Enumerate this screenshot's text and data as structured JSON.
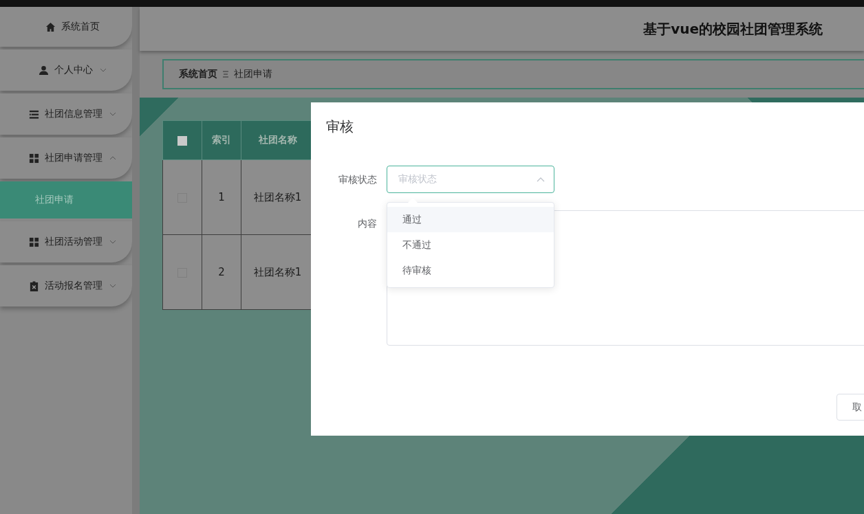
{
  "header": {
    "title": "基于vue的校园社团管理系统"
  },
  "sidebar": {
    "items": [
      {
        "label": "系统首页",
        "selected": false
      },
      {
        "label": "个人中心",
        "selected": false,
        "expanded": false
      },
      {
        "label": "社团信息管理",
        "selected": false,
        "expanded": false
      },
      {
        "label": "社团申请管理",
        "selected": false,
        "expanded": true,
        "children": [
          {
            "label": "社团申请",
            "selected": true
          }
        ]
      },
      {
        "label": "社团活动管理",
        "selected": false,
        "expanded": false
      },
      {
        "label": "活动报名管理",
        "selected": false,
        "expanded": false
      }
    ]
  },
  "breadcrumb": [
    "系统首页",
    "社团申请"
  ],
  "table": {
    "header_checked": false,
    "columns": [
      "索引",
      "社团名称"
    ],
    "rows": [
      {
        "checked": false,
        "cells": [
          "1",
          "社团名称1"
        ]
      },
      {
        "checked": false,
        "cells": [
          "2",
          "社团名称1"
        ]
      }
    ]
  },
  "dialog": {
    "title": "审核",
    "fields": [
      {
        "kind": "select",
        "label": "审核状态",
        "placeholder": "审核状态",
        "expanded": true,
        "options": [
          {
            "label": "通过",
            "highlighted": true
          },
          {
            "label": "不通过",
            "highlighted": false
          },
          {
            "label": "待审核",
            "highlighted": false
          }
        ]
      },
      {
        "kind": "textarea",
        "label": "内容"
      }
    ],
    "buttons": [
      "取"
    ]
  }
}
